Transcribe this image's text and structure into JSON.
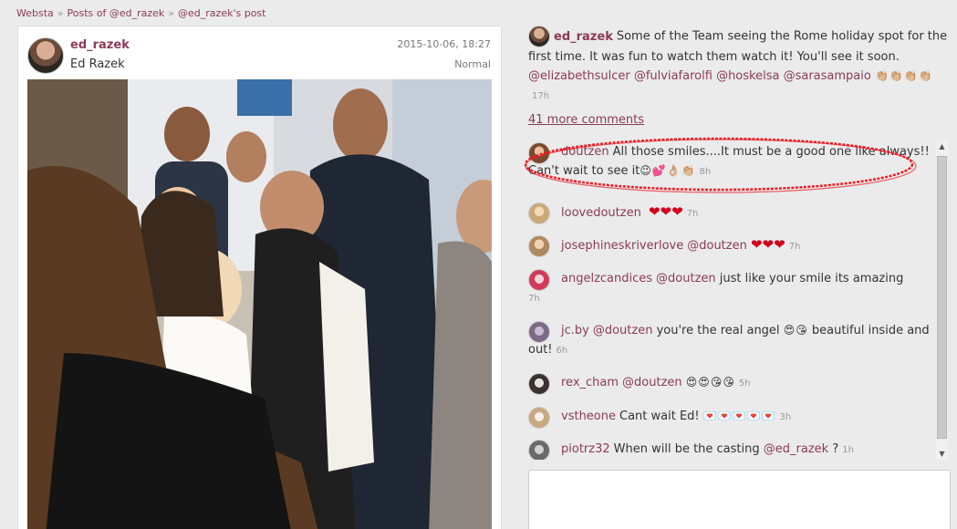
{
  "breadcrumb": {
    "items": [
      "Websta",
      "Posts of @ed_razek",
      "@ed_razek's post"
    ],
    "separator": "»"
  },
  "post": {
    "username": "ed_razek",
    "full_name": "Ed Razek",
    "date": "2015-10-06, 18:27",
    "filter": "Normal",
    "photo_icon": "group-photo"
  },
  "caption": {
    "username": "ed_razek",
    "text": "Some of the Team seeing the Rome holiday spot for the first time. It was fun to watch them watch it! You'll see it soon.",
    "mentions": [
      "@elizabethsulcer",
      "@fulviafarolfi",
      "@hoskelsa",
      "@sarasampaio"
    ],
    "emoji": "👏🏼👏🏼👏🏼👏🏼",
    "time": "17h"
  },
  "more_comments": "41 more comments",
  "comments": [
    {
      "username": "doutzen",
      "text": "All those smiles....It must be a good one like always!! Can't wait to see it",
      "emoji": "😉💕👌🏼👏🏼",
      "time": "8h",
      "highlighted": true
    },
    {
      "username": "loovedoutzen",
      "text": "",
      "emoji": "❤❤❤",
      "time": "7h"
    },
    {
      "username": "josephineskriverlove",
      "mention": "@doutzen",
      "text": "",
      "emoji": "❤❤❤",
      "time": "7h"
    },
    {
      "username": "angelzcandices",
      "mention": "@doutzen",
      "text": "just like your smile its amazing",
      "time": "7h"
    },
    {
      "username": "jc.by",
      "mention": "@doutzen",
      "text": "you're the real angel",
      "emoji": "😍😘",
      "text2": "beautiful inside and out!",
      "time": "6h"
    },
    {
      "username": "rex_cham",
      "mention": "@doutzen",
      "text": "",
      "emoji": "😍😍😘😘",
      "time": "5h"
    },
    {
      "username": "vstheone",
      "text": "Cant wait Ed!",
      "emoji": "💌💌💌💌💌",
      "time": "3h"
    },
    {
      "username": "piotrz32",
      "text": "When will be the casting",
      "mention": "@ed_razek",
      "text2": "?",
      "time": "1h"
    }
  ],
  "colors": {
    "accent": "#8a3b55",
    "background": "#ebebeb",
    "highlight": "#e8202a"
  }
}
